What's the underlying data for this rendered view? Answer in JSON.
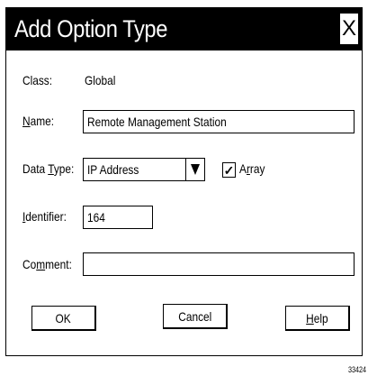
{
  "dialog": {
    "title": "Add Option Type",
    "close_label": "X"
  },
  "class_row": {
    "label": "Class:",
    "value": "Global"
  },
  "name_row": {
    "label_mnemonic": "N",
    "label_rest": "ame:",
    "value": "Remote Management Station"
  },
  "datatype_row": {
    "label_pre": "Data ",
    "label_mnemonic": "T",
    "label_rest": "ype:",
    "value": "IP Address",
    "array_label_pre": "A",
    "array_label_mnemonic": "r",
    "array_label_rest": "ray",
    "array_checked": true,
    "check_mark": "✓"
  },
  "identifier_row": {
    "label_mnemonic": "I",
    "label_rest": "dentifier:",
    "value": "164"
  },
  "comment_row": {
    "label_pre": "Co",
    "label_mnemonic": "m",
    "label_rest": "ment:",
    "value": ""
  },
  "buttons": {
    "ok": "OK",
    "cancel": "Cancel",
    "help_mnemonic": "H",
    "help_rest": "elp"
  },
  "figure_id": "33424"
}
